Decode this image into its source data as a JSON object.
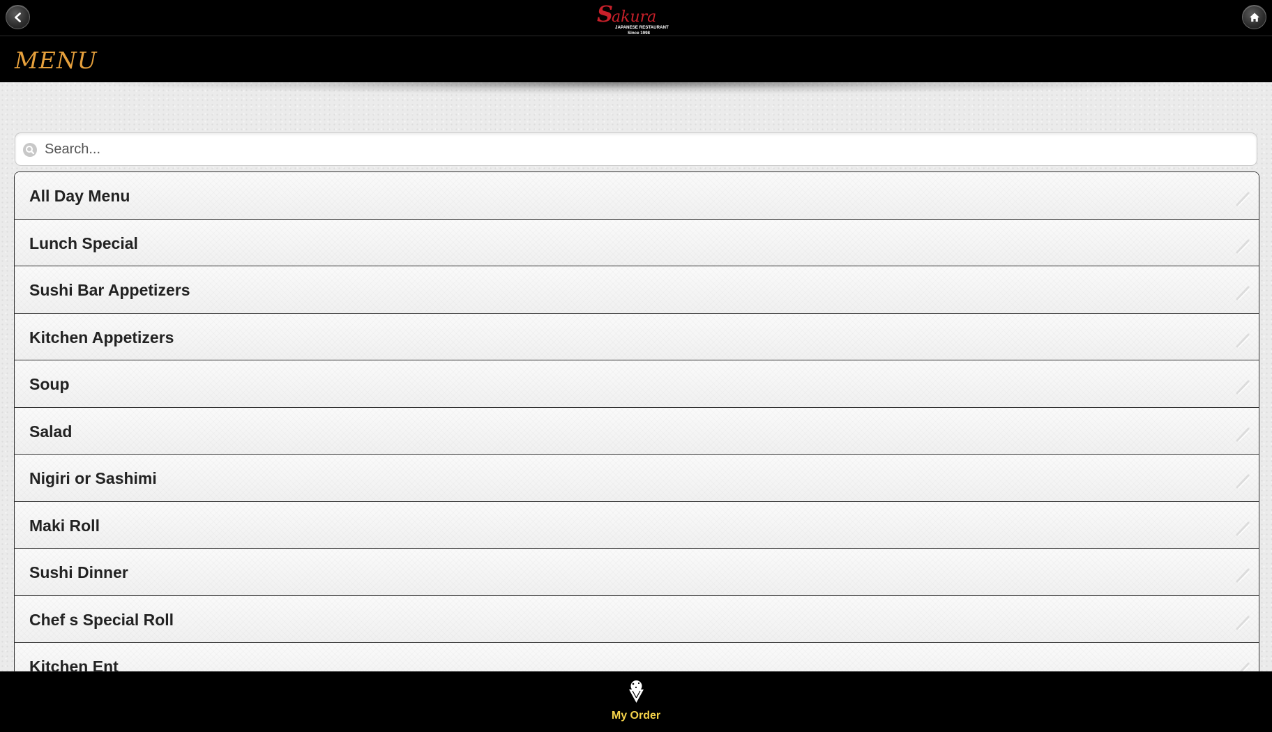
{
  "header": {
    "back_icon": "chevron-left-icon",
    "home_icon": "home-icon",
    "logo": {
      "name": "Sakura",
      "subtitle": "JAPANESE RESTAURANT",
      "since": "Since 1998"
    }
  },
  "title": "MENU",
  "search": {
    "placeholder": "Search...",
    "value": "",
    "icon": "search-icon"
  },
  "menu": {
    "items": [
      {
        "label": "All Day Menu"
      },
      {
        "label": "Lunch Special"
      },
      {
        "label": "Sushi Bar Appetizers"
      },
      {
        "label": "Kitchen Appetizers"
      },
      {
        "label": "Soup"
      },
      {
        "label": "Salad"
      },
      {
        "label": "Nigiri or Sashimi"
      },
      {
        "label": "Maki Roll"
      },
      {
        "label": "Sushi Dinner"
      },
      {
        "label": "Chef s Special Roll"
      },
      {
        "label": "Kitchen Ent"
      }
    ],
    "arrow_icon": "chevron-right-icon"
  },
  "footer": {
    "order_label": "My Order",
    "order_icon": "ice-cream-icon"
  },
  "colors": {
    "bar_background": "#000000",
    "title_color": "#e6a03c",
    "order_label_color": "#f5d34a",
    "logo_red": "#c8202a"
  }
}
